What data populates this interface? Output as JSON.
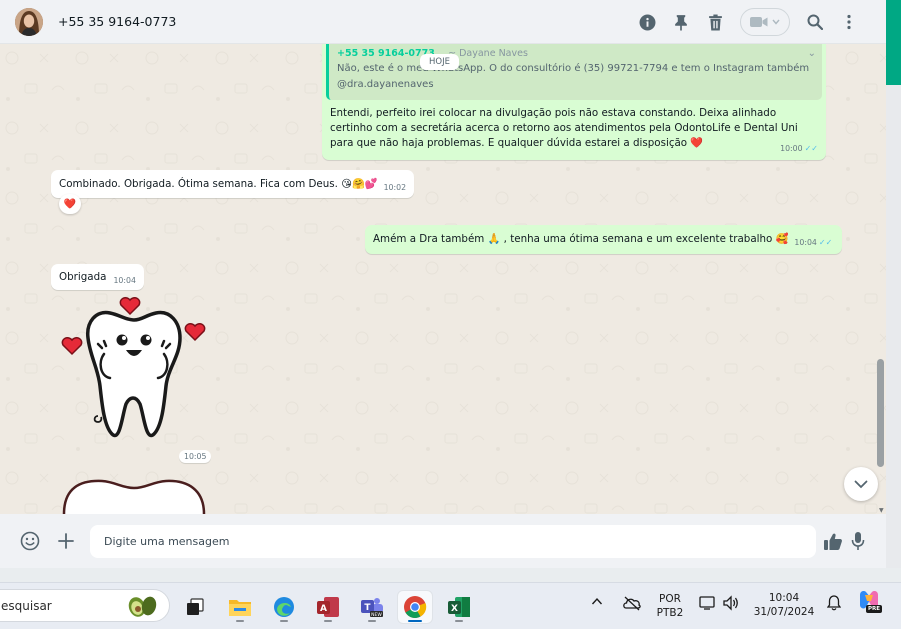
{
  "header": {
    "contact_name": "+55 35 9164-0773",
    "icons": [
      "info-icon",
      "pin-icon",
      "trash-icon",
      "video-call-icon",
      "search-icon",
      "menu-icon"
    ]
  },
  "chat": {
    "date_chip": "HOJE",
    "messages": [
      {
        "direction": "out",
        "quoted_phone": "+55 35 9164-0773",
        "quoted_name": "~ Dayane Naves",
        "quoted_text": "Não, este é o meu WhatsApp. O do consultório é (35) 99721-7794 e tem o Instagram também @dra.dayanenaves",
        "text": "Entendi, perfeito irei colocar na divulgação pois não estava constando. Deixa alinhado certinho com a secretária acerca o retorno aos atendimentos pela OdontoLife e Dental Uni para que não haja problemas. E qualquer dúvida estarei a disposição ❤️",
        "time": "10:00"
      },
      {
        "direction": "in",
        "text": "Combinado. Obrigada. Ótima semana. Fica com Deus. 😘🤗💕",
        "time": "10:02",
        "reaction": "❤️"
      },
      {
        "direction": "out",
        "text": "Amém a Dra também 🙏 , tenha uma ótima semana e um excelente trabalho 🥰",
        "time": "10:04"
      },
      {
        "direction": "in",
        "text": "Obrigada",
        "time": "10:04"
      },
      {
        "direction": "in",
        "type": "sticker",
        "sticker": "happy-tooth-sticker",
        "time": "10:05"
      }
    ]
  },
  "composer": {
    "placeholder": "Digite uma mensagem"
  },
  "taskbar": {
    "search_text": "esquisar",
    "lang_line1": "POR",
    "lang_line2": "PTB2",
    "clock_time": "10:04",
    "clock_date": "31/07/2024",
    "copilot_badge": "PRE"
  },
  "colors": {
    "outgoing_bubble": "#d9fdd3",
    "incoming_bubble": "#ffffff",
    "chat_bg": "#efeae2",
    "accent": "#00a884",
    "read_ticks": "#53bdeb"
  }
}
